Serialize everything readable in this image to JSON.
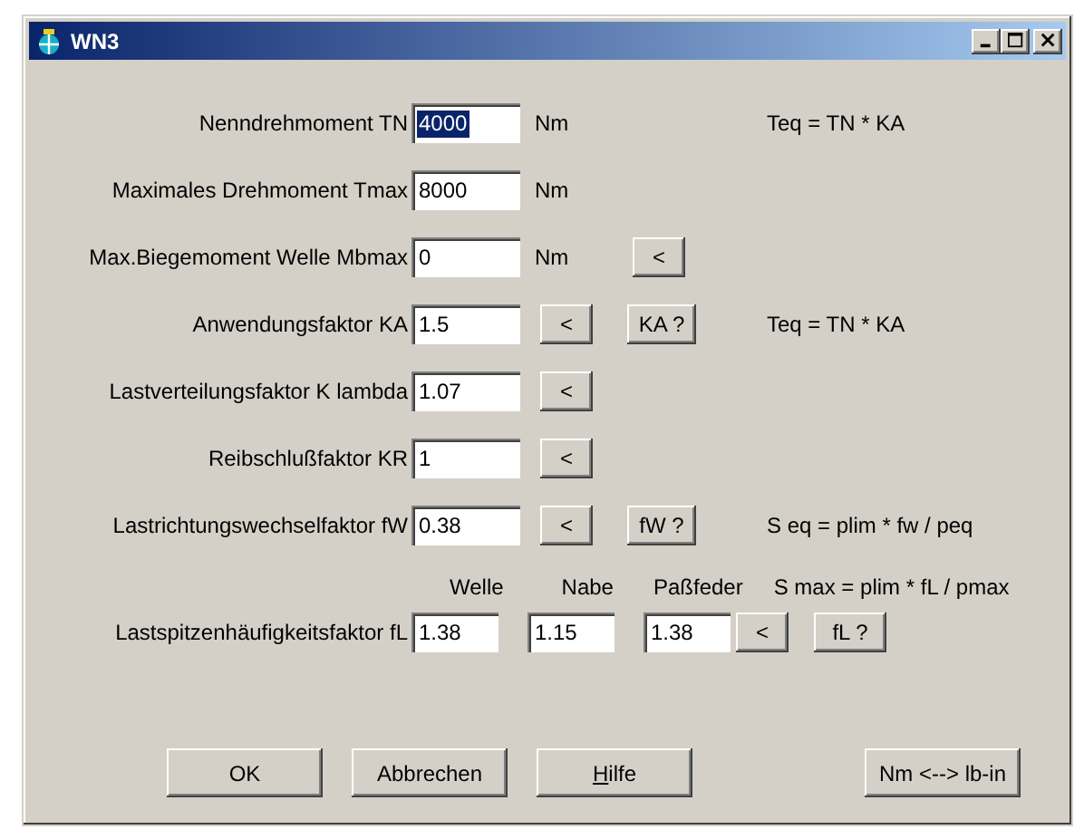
{
  "window": {
    "title": "WN3"
  },
  "rows": [
    {
      "label": "Nenndrehmoment TN",
      "value": "4000",
      "highlighted": true,
      "unit": "Nm",
      "buttons": [],
      "note": "Teq = TN * KA"
    },
    {
      "label": "Maximales Drehmoment Tmax",
      "value": "8000",
      "highlighted": false,
      "unit": "Nm",
      "buttons": []
    },
    {
      "label": "Max.Biegemoment Welle Mbmax",
      "value": "0",
      "highlighted": false,
      "unit": "Nm",
      "buttons": [
        "<"
      ]
    },
    {
      "label": "Anwendungsfaktor KA",
      "value": "1.5",
      "highlighted": false,
      "buttons": [
        "<",
        "KA ?"
      ],
      "note": "Teq = TN * KA"
    },
    {
      "label": "Lastverteilungsfaktor K lambda",
      "value": "1.07",
      "highlighted": false,
      "buttons": [
        "<"
      ]
    },
    {
      "label": "Reibschlußfaktor KR",
      "value": "1",
      "highlighted": false,
      "buttons": [
        "<"
      ]
    },
    {
      "label": "Lastrichtungswechselfaktor fW",
      "value": "0.38",
      "highlighted": false,
      "buttons": [
        "<",
        "fW ?"
      ],
      "note": "S eq = plim * fw / peq"
    }
  ],
  "peak": {
    "label": "Lastspitzenhäufigkeitsfaktor fL",
    "note": "S max = plim * fL / pmax",
    "columns": [
      {
        "header": "Welle",
        "value": "1.38"
      },
      {
        "header": "Nabe",
        "value": "1.15"
      },
      {
        "header": "Paßfeder",
        "value": "1.38"
      }
    ],
    "buttons": [
      "<",
      "fL ?"
    ]
  },
  "buttons": [
    "OK",
    "Abbrechen",
    "Hilfe",
    "Nm <--> lb-in"
  ]
}
